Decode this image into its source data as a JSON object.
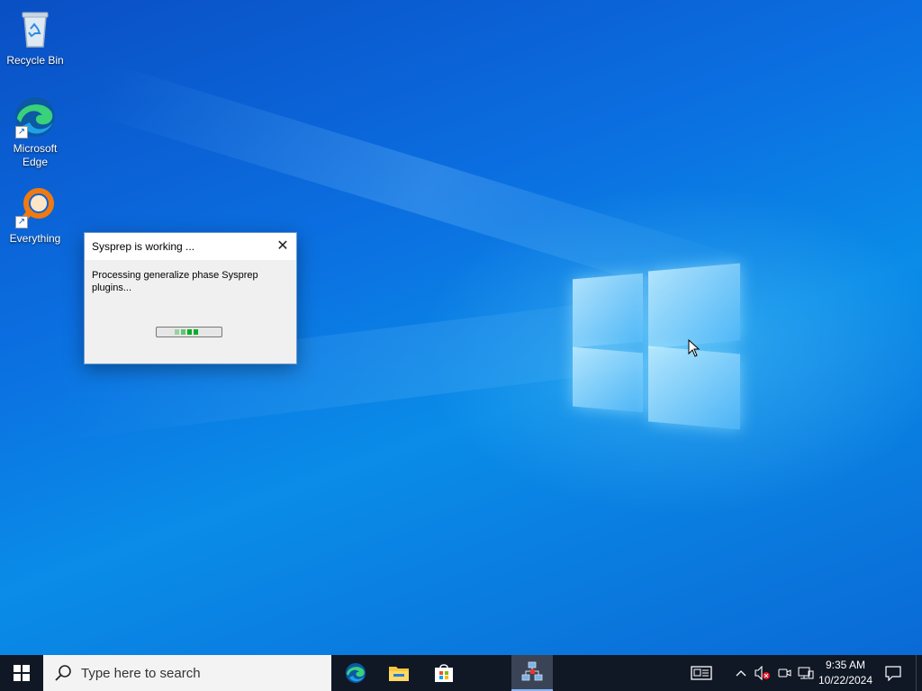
{
  "desktop": {
    "icons": [
      {
        "label": "Recycle Bin",
        "icon": "recycle-bin-icon"
      },
      {
        "label": "Microsoft Edge",
        "icon": "edge-icon"
      },
      {
        "label": "Everything",
        "icon": "everything-search-icon"
      }
    ]
  },
  "dialog": {
    "title": "Sysprep is working ...",
    "message": "Processing generalize phase Sysprep plugins...",
    "close_symbol": "✕",
    "progress_color": "#06b025"
  },
  "taskbar": {
    "search_placeholder": "Type here to search",
    "pinned": [
      {
        "name": "Microsoft Edge",
        "icon": "edge-icon"
      },
      {
        "name": "File Explorer",
        "icon": "file-explorer-icon"
      },
      {
        "name": "Microsoft Store",
        "icon": "store-icon"
      },
      {
        "name": "Sysprep",
        "icon": "sysprep-icon"
      }
    ],
    "tray": {
      "time": "9:35 AM",
      "date": "10/22/2024"
    }
  },
  "colors": {
    "taskbar": "#101826",
    "desktop_blue": "#0b6ee0"
  }
}
